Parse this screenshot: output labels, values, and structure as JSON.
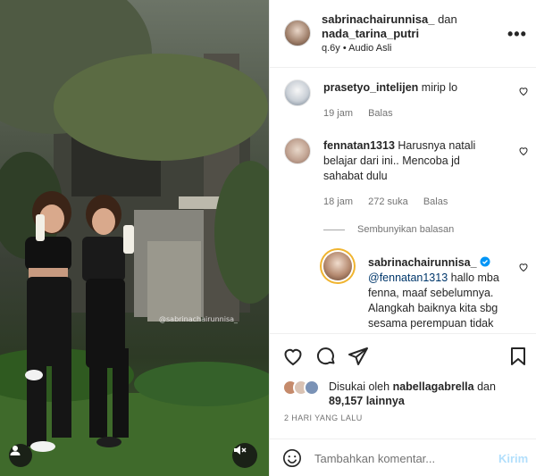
{
  "post": {
    "author": "sabrinachairunnisa_",
    "connector": "dan",
    "coauthor": "nada_tarina_putri",
    "subtitle": "q.6y • Audio Asli",
    "watermark": "@sabrinachairunnisa_"
  },
  "comments": [
    {
      "username": "prasetyo_intelijen",
      "text": "mirip lo",
      "time": "19 jam",
      "reply_label": "Balas"
    },
    {
      "username": "fennatan1313",
      "text": "Harusnya natali belajar dari ini.. Mencoba jd sahabat dulu",
      "time": "18 jam",
      "likes": "272 suka",
      "reply_label": "Balas"
    }
  ],
  "hide_replies_label": "Sembunyikan balasan",
  "reply": {
    "username": "sabrinachairunnisa_",
    "mention": "@fennatan1313",
    "text": "hallo mba fenna, maaf sebelumnya. Alangkah baiknya kita sbg sesama perempuan tidak"
  },
  "likes": {
    "prefix": "Disukai oleh",
    "user": "nabellagabrella",
    "connector": "dan",
    "count": "89,157 lainnya"
  },
  "date": "2 HARI YANG LALU",
  "compose": {
    "placeholder": "Tambahkan komentar...",
    "send_label": "Kirim"
  },
  "icons": {
    "like": "heart-icon",
    "comment": "comment-icon",
    "share": "send-icon",
    "save": "bookmark-icon",
    "more": "more-icon",
    "mute": "mute-icon",
    "emoji": "emoji-icon",
    "verified": "verified-icon"
  },
  "colors": {
    "accent": "#0095f6",
    "send_disabled": "#b2dffc",
    "verified": "#0095f6"
  }
}
